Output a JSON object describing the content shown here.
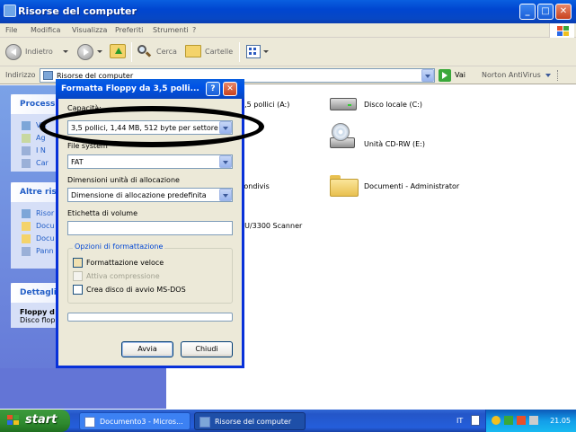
{
  "window": {
    "title": "Risorse del computer",
    "min": "_",
    "max": "□",
    "close": "✕"
  },
  "menu": [
    "File",
    "Modifica",
    "Visualizza",
    "Preferiti",
    "Strumenti",
    "?"
  ],
  "toolbar": {
    "back": "Indietro",
    "search": "Cerca",
    "folders": "Cartelle"
  },
  "address": {
    "label": "Indirizzo",
    "value": "Risorse del computer",
    "go": "Vai",
    "norton": "Norton AntiVirus"
  },
  "taskpane": {
    "box1": {
      "title": "Process",
      "items": [
        "Vis",
        "Ag",
        "I N",
        "Car"
      ]
    },
    "box2": {
      "title": "Altre riso",
      "items": [
        "Risor",
        "Docu",
        "Docu",
        "Pann"
      ]
    },
    "box3": {
      "title": "Dettagli",
      "line1": "Floppy d",
      "line2": "Disco flop"
    }
  },
  "content": {
    "items": [
      {
        "label": "3,5 pollici (A:)"
      },
      {
        "label": "Disco locale (C:)"
      },
      {
        "label": "Unità CD-RW (E:)"
      },
      {
        "label": "condivis"
      },
      {
        "label": "Documenti - Administrator"
      },
      {
        "label": "0U/3300 Scanner"
      }
    ]
  },
  "dialog": {
    "title": "Formatta Floppy da 3,5 polli...",
    "help": "?",
    "close": "✕",
    "capacity_label": "Capacità:",
    "capacity_value": "3,5 pollici, 1,44 MB, 512 byte per settore",
    "filesystem_label": "File system",
    "filesystem_value": "FAT",
    "alloc_label": "Dimensioni unità di allocazione",
    "alloc_value": "Dimensione di allocazione predefinita",
    "volume_label": "Etichetta di volume",
    "volume_value": "",
    "options_title": "Opzioni di formattazione",
    "opt_quick": "Formattazione veloce",
    "opt_compress": "Attiva compressione",
    "opt_msdos": "Crea disco di avvio MS-DOS",
    "btn_start": "Avvia",
    "btn_close": "Chiudi",
    "progress": 0
  },
  "taskbar": {
    "start": "start",
    "tasks": [
      "Documento3 - Micros...",
      "Risorse del computer"
    ],
    "lang": "IT",
    "clock": "21.05"
  },
  "colors": {
    "xp_blue": "#0053e6",
    "start_green": "#2f8a2f",
    "dialog_bg": "#ece9d8"
  }
}
